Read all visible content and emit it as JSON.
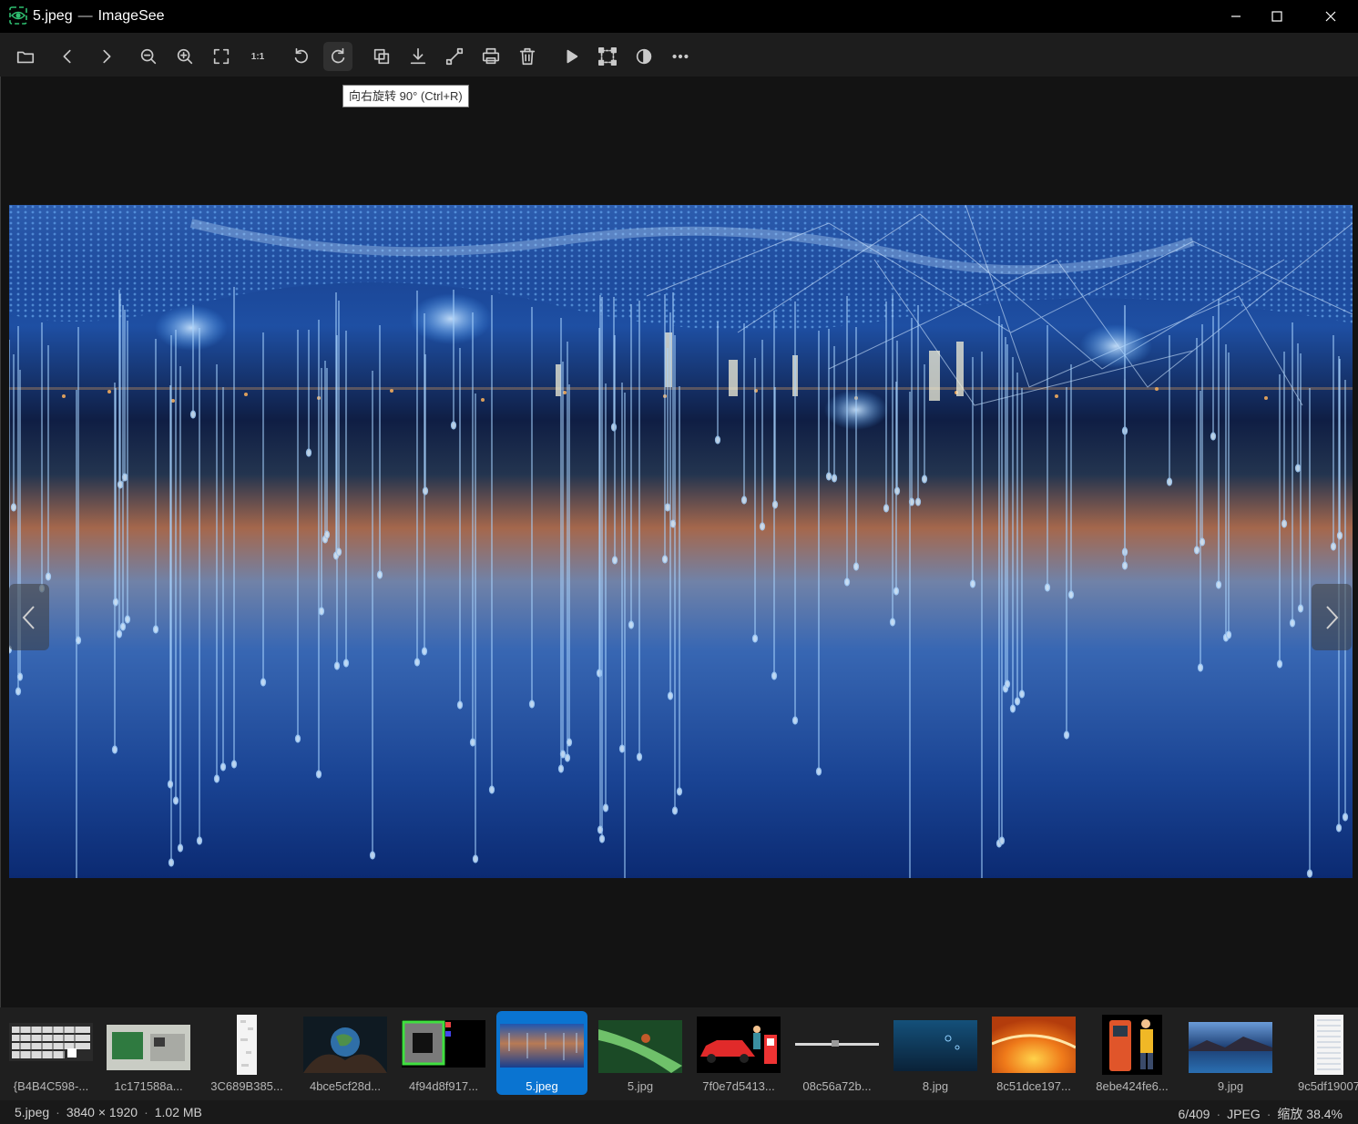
{
  "window": {
    "file_name": "5.jpeg",
    "separator": "—",
    "app_name": "ImageSee"
  },
  "toolbar": {
    "buttons": [
      {
        "name": "open-folder",
        "icon": "folder-icon"
      },
      {
        "name": "previous",
        "icon": "chevron-left-icon"
      },
      {
        "name": "next",
        "icon": "chevron-right-icon"
      },
      {
        "name": "zoom-out",
        "icon": "zoom-out-icon"
      },
      {
        "name": "zoom-in",
        "icon": "zoom-in-icon"
      },
      {
        "name": "fit-window",
        "icon": "fit-screen-icon"
      },
      {
        "name": "actual-size",
        "label": "1:1"
      },
      {
        "name": "rotate-left",
        "icon": "rotate-ccw-icon"
      },
      {
        "name": "rotate-right",
        "icon": "rotate-cw-icon",
        "active": true
      },
      {
        "name": "copy",
        "icon": "copy-icon"
      },
      {
        "name": "save",
        "icon": "download-icon"
      },
      {
        "name": "resize",
        "icon": "resize-icon"
      },
      {
        "name": "print",
        "icon": "printer-icon"
      },
      {
        "name": "delete",
        "icon": "trash-icon"
      },
      {
        "name": "slideshow",
        "icon": "play-icon"
      },
      {
        "name": "crop",
        "icon": "crop-icon"
      },
      {
        "name": "adjust",
        "icon": "contrast-icon"
      },
      {
        "name": "more",
        "icon": "more-icon"
      }
    ],
    "tooltip": "向右旋转 90° (Ctrl+R)"
  },
  "viewer": {
    "prev_icon": "chevron-left-icon",
    "next_icon": "chevron-right-icon"
  },
  "filmstrip": {
    "items": [
      {
        "caption": "{B4B4C598-...",
        "kind": "keyboard"
      },
      {
        "caption": "1c171588a...",
        "kind": "circuit"
      },
      {
        "caption": "3C689B385...",
        "kind": "white-tall"
      },
      {
        "caption": "4bce5cf28d...",
        "kind": "earth-hands"
      },
      {
        "caption": "4f94d8f917...",
        "kind": "qr-green"
      },
      {
        "caption": "5.jpeg",
        "kind": "tech-blue",
        "active": true
      },
      {
        "caption": "5.jpg",
        "kind": "green-leaf"
      },
      {
        "caption": "7f0e7d5413...",
        "kind": "red-car"
      },
      {
        "caption": "08c56a72b...",
        "kind": "thin-line"
      },
      {
        "caption": "8.jpg",
        "kind": "underwater"
      },
      {
        "caption": "8c51dce197...",
        "kind": "sunset"
      },
      {
        "caption": "8ebe424fe6...",
        "kind": "fuel-pump"
      },
      {
        "caption": "9.jpg",
        "kind": "lake"
      },
      {
        "caption": "9c5df19007",
        "kind": "document"
      }
    ]
  },
  "status": {
    "file_name": "5.jpeg",
    "dimensions": "3840 × 1920",
    "file_size": "1.02 MB",
    "position": "6/409",
    "format": "JPEG",
    "zoom": "缩放 38.4%",
    "separator": "·"
  }
}
